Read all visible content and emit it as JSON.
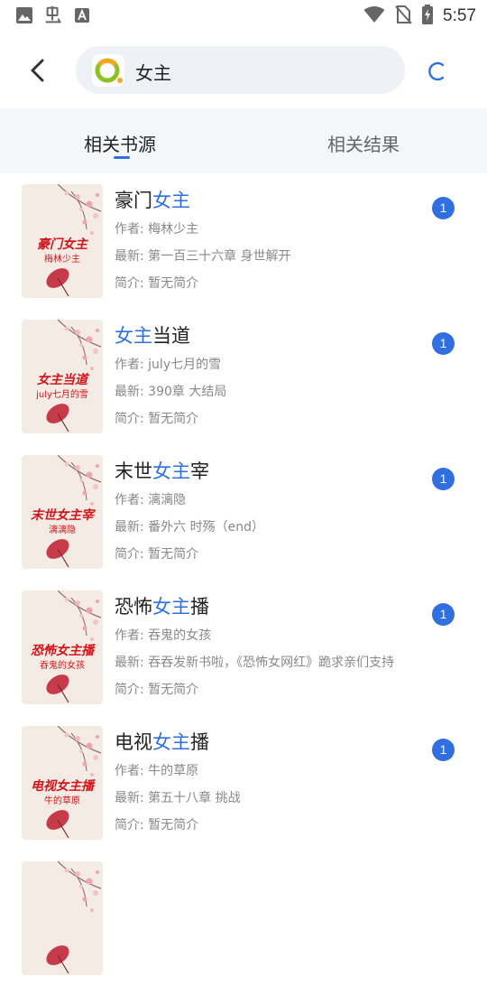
{
  "status_bar": {
    "time": "5:57",
    "left_icons": [
      "image-icon",
      "app-glyph-icon",
      "a-box-icon"
    ],
    "right_icons": [
      "wifi-icon",
      "no-sim-icon",
      "battery-charging-icon"
    ]
  },
  "search": {
    "value": "女主"
  },
  "tabs": [
    {
      "label": "相关书源",
      "active": true
    },
    {
      "label": "相关结果",
      "active": false
    }
  ],
  "colors": {
    "accent": "#2f6fe0",
    "cover_text": "#d4151b",
    "badge": "#2f6fe0"
  },
  "results": [
    {
      "cover_title": "豪门女主",
      "cover_author": "梅林少主",
      "title_parts": [
        "豪门",
        "女主",
        ""
      ],
      "author": "作者: 梅林少主",
      "latest": "最新: 第一百三十六章 身世解开",
      "intro": "简介: 暂无简介",
      "count": "1"
    },
    {
      "cover_title": "女主当道",
      "cover_author": "july七月的雪",
      "title_parts": [
        "",
        "女主",
        "当道"
      ],
      "author": "作者: july七月的雪",
      "latest": "最新: 390章 大结局",
      "intro": "简介: 暂无简介",
      "count": "1"
    },
    {
      "cover_title": "末世女主宰",
      "cover_author": "漓漓隐",
      "title_parts": [
        "末世",
        "女主",
        "宰"
      ],
      "author": "作者: 漓漓隐",
      "latest": "最新: 番外六 时殇（end）",
      "intro": "简介: 暂无简介",
      "count": "1"
    },
    {
      "cover_title": "恐怖女主播",
      "cover_author": "吞鬼的女孩",
      "title_parts": [
        "恐怖",
        "女主",
        "播"
      ],
      "author": "作者: 吞鬼的女孩",
      "latest": "最新: 吞吞发新书啦，《恐怖女网红》跪求亲们支持",
      "intro": "简介: 暂无简介",
      "count": "1"
    },
    {
      "cover_title": "电视女主播",
      "cover_author": "牛的草原",
      "title_parts": [
        "电视",
        "女主",
        "播"
      ],
      "author": "作者: 牛的草原",
      "latest": "最新: 第五十八章 挑战",
      "intro": "简介: 暂无简介",
      "count": "1"
    }
  ]
}
